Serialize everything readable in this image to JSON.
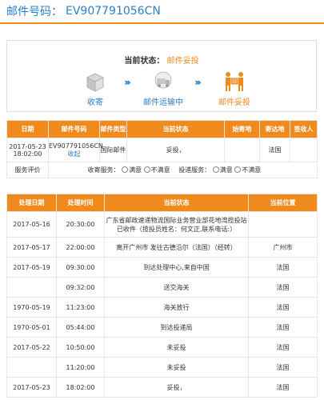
{
  "header": {
    "label": "邮件号码：",
    "number": "EV907791056CN"
  },
  "status": {
    "current_label": "当前状态：",
    "current_value": "邮件妥投",
    "steps": [
      {
        "label": "收寄",
        "icon": "package-icon"
      },
      {
        "label": "邮件运输中",
        "icon": "transport-icon"
      },
      {
        "label": "邮件妥投",
        "icon": "delivered-icon"
      }
    ],
    "arrow_icon": "double-chevron-right-icon"
  },
  "summary_table": {
    "headers": [
      "日期",
      "邮件号码",
      "邮件类型",
      "当前状态",
      "始寄地",
      "寄达地",
      "签收人"
    ],
    "row": {
      "date": "2017-05-23 18:02:00",
      "number": "EV907791056CN",
      "link": "收起",
      "type": "国际邮件",
      "state": "妥投，",
      "origin": "",
      "dest": "法国",
      "signer": ""
    },
    "eval": {
      "label": "服务评价",
      "groups": [
        {
          "label": "收寄服务：",
          "opt1": "满意",
          "opt2": "不满意"
        },
        {
          "label": "投递服务：",
          "opt1": "满意",
          "opt2": "不满意"
        }
      ]
    }
  },
  "detail_table": {
    "headers": [
      "处理日期",
      "处理时间",
      "当前状态",
      "当前位置"
    ],
    "rows": [
      {
        "date": "2017-05-16",
        "time": "20:30:00",
        "state": "广东省邮政速递物流国际业务营业部花地湾揽投站已收件（揽投员姓名：何文正,联系电话:）",
        "loc": ""
      },
      {
        "date": "2017-05-17",
        "time": "22:00:00",
        "state": "离开广州市 发往古德沿尔（法国）（经转）",
        "loc": "广州市"
      },
      {
        "date": "2017-05-19",
        "time": "09:30:00",
        "state": "到达处理中心,来自中国",
        "loc": "法国"
      },
      {
        "date": "",
        "time": "09:32:00",
        "state": "送交海关",
        "loc": "法国"
      },
      {
        "date": "1970-05-19",
        "time": "11:23:00",
        "state": "海关放行",
        "loc": "法国"
      },
      {
        "date": "1970-05-01",
        "time": "05:44:00",
        "state": "到达投递局",
        "loc": "法国"
      },
      {
        "date": "2017-05-22",
        "time": "10:50:00",
        "state": "未妥投",
        "loc": "法国"
      },
      {
        "date": "",
        "time": "11:20:00",
        "state": "未妥投",
        "loc": "法国"
      },
      {
        "date": "2017-05-23",
        "time": "18:02:00",
        "state": "妥投，",
        "loc": "法国"
      }
    ]
  },
  "colors": {
    "accent": "#f08a1c",
    "link": "#2b7fc7"
  }
}
